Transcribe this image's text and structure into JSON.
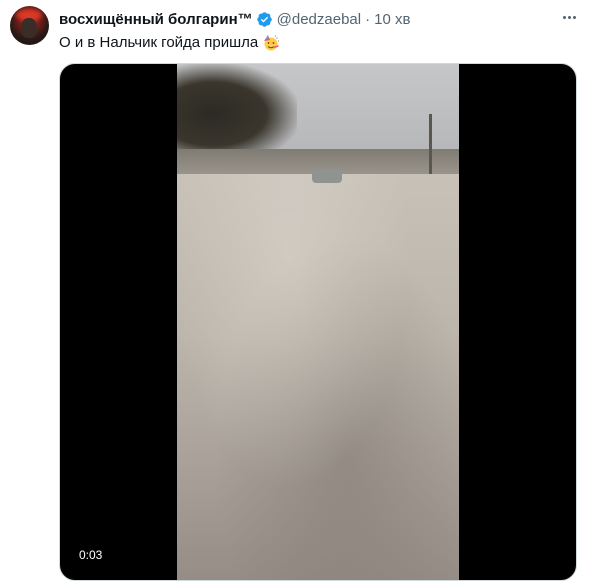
{
  "tweet": {
    "display_name": "восхищённый болгарин™",
    "handle": "@dedzaebal",
    "separator": "·",
    "time": "10 хв",
    "text": "О и в Нальчик гойда пришла",
    "emoji": "party-face-emoji"
  },
  "media": {
    "duration": "0:03"
  },
  "colors": {
    "verified": "#1d9bf0",
    "secondary_text": "#536471",
    "primary_text": "#0f1419",
    "media_background": "#000000"
  },
  "icons": {
    "verified": "verified-badge-icon",
    "more": "more-options-icon"
  }
}
